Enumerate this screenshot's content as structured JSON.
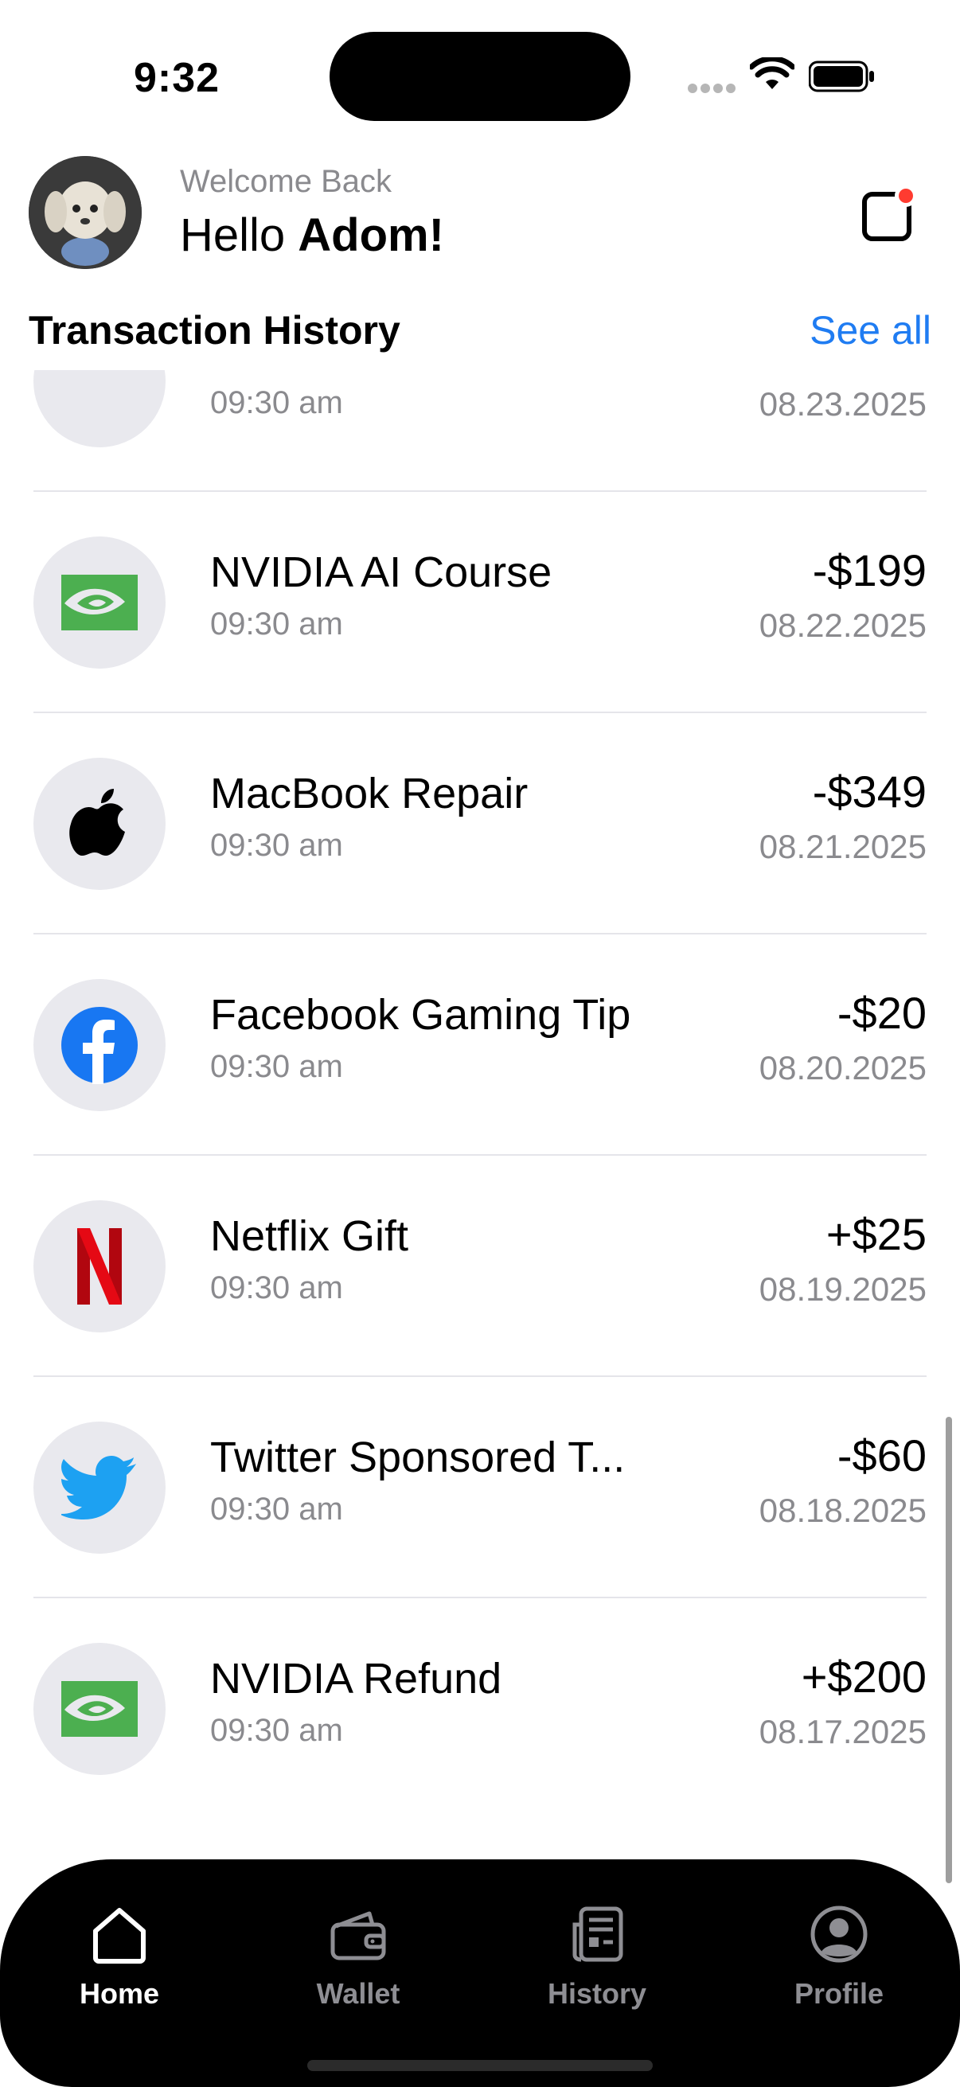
{
  "status_bar": {
    "time": "9:32"
  },
  "header": {
    "welcome": "Welcome Back",
    "greeting_prefix": "Hello ",
    "user_name": "Adom!"
  },
  "section": {
    "title": "Transaction History",
    "see_all": "See all"
  },
  "transactions": [
    {
      "title": "",
      "time": "09:30 am",
      "amount": "",
      "date": "08.23.2025",
      "icon": "partial-hidden-icon"
    },
    {
      "title": "NVIDIA AI Course",
      "time": "09:30 am",
      "amount": "-$199",
      "date": "08.22.2025",
      "icon": "nvidia-icon"
    },
    {
      "title": "MacBook Repair",
      "time": "09:30 am",
      "amount": "-$349",
      "date": "08.21.2025",
      "icon": "apple-icon"
    },
    {
      "title": "Facebook Gaming Tip",
      "time": "09:30 am",
      "amount": "-$20",
      "date": "08.20.2025",
      "icon": "facebook-icon"
    },
    {
      "title": "Netflix Gift",
      "time": "09:30 am",
      "amount": "+$25",
      "date": "08.19.2025",
      "icon": "netflix-icon"
    },
    {
      "title": "Twitter Sponsored T...",
      "time": "09:30 am",
      "amount": "-$60",
      "date": "08.18.2025",
      "icon": "twitter-icon"
    },
    {
      "title": "NVIDIA Refund",
      "time": "09:30 am",
      "amount": "+$200",
      "date": "08.17.2025",
      "icon": "nvidia-icon"
    }
  ],
  "tab_bar": {
    "tabs": [
      {
        "label": "Home",
        "icon": "home-icon",
        "active": true
      },
      {
        "label": "Wallet",
        "icon": "wallet-icon",
        "active": false
      },
      {
        "label": "History",
        "icon": "history-icon",
        "active": false
      },
      {
        "label": "Profile",
        "icon": "profile-icon",
        "active": false
      }
    ]
  },
  "colors": {
    "accent": "#1f7cf2",
    "notification": "#ff3b30",
    "nvidia": "#4caf50",
    "facebook": "#1877f2",
    "netflix": "#e50914",
    "twitter": "#1da1f2"
  }
}
